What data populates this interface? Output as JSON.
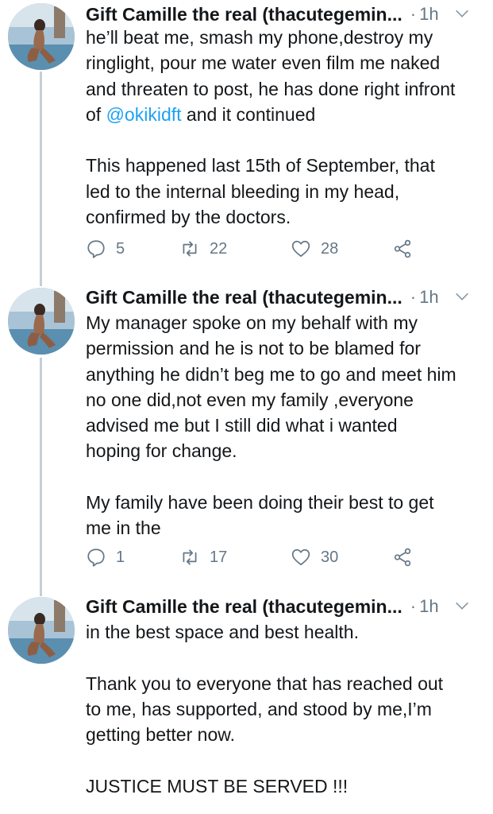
{
  "tweets": [
    {
      "author": "Gift Camille the real (thacutegemin...",
      "separator": "·",
      "time": "1h",
      "paragraphs": [
        [
          "he’ll beat me, smash my phone,destroy my",
          "ringlight, pour me water even film me naked",
          "and threaten to post, he has done right infront"
        ],
        [
          "This happened last 15th of September, that",
          "led to the internal bleeding in my head,",
          "confirmed by the doctors."
        ]
      ],
      "mention_line": {
        "prefix": "of ",
        "mention": "@okikidft",
        "suffix": " and it continued"
      },
      "replies": "5",
      "retweets": "22",
      "likes": "28"
    },
    {
      "author": "Gift Camille the real (thacutegemin...",
      "separator": "·",
      "time": "1h",
      "paragraphs": [
        [
          "My manager spoke on my behalf with my",
          "permission and he is not to be blamed for",
          "anything he didn’t beg me to go and meet him",
          "no one did,not even my family ,everyone",
          "advised me but I still did what i wanted",
          "hoping for change."
        ],
        [
          "My family have been doing their best to get",
          "me in the"
        ]
      ],
      "replies": "1",
      "retweets": "17",
      "likes": "30"
    },
    {
      "author": "Gift Camille the real (thacutegemin...",
      "separator": "·",
      "time": "1h",
      "paragraphs": [
        [
          "in the best space and best health."
        ],
        [
          "Thank you to everyone that has reached out",
          "to me, has supported, and stood by me,I’m",
          "getting better now."
        ],
        [
          "JUSTICE MUST BE SERVED !!!"
        ]
      ]
    }
  ],
  "icons": {
    "reply": "reply-icon",
    "retweet": "retweet-icon",
    "like": "heart-icon",
    "share": "share-icon",
    "more": "chevron-down-icon",
    "avatar": "profile-photo"
  },
  "colors": {
    "text": "#14171a",
    "muted": "#657786",
    "link": "#1da1f2",
    "thread_line": "#c4cfd6"
  }
}
